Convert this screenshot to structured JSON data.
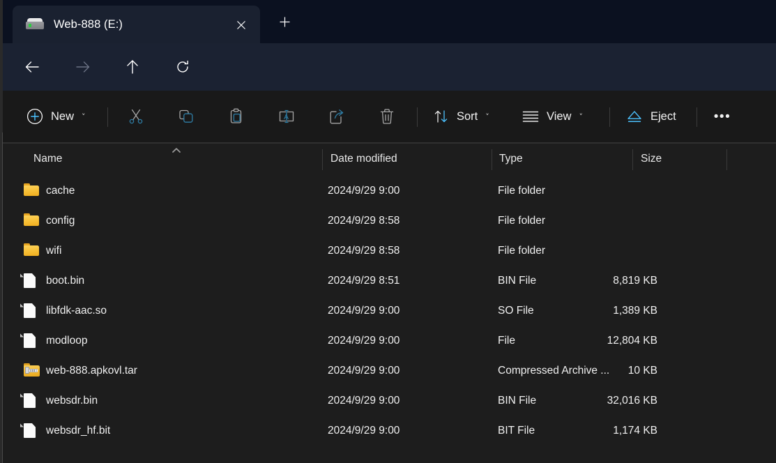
{
  "window": {
    "tab": {
      "title": "Web-888 (E:)",
      "icon": "drive-icon",
      "close_label": "✕"
    },
    "new_tab_label": "+"
  },
  "navigation": {
    "back": "back-arrow",
    "forward": "forward-arrow",
    "up": "up-arrow",
    "refresh": "refresh-icon",
    "breadcrumb": {
      "home_icon": "this-pc-icon",
      "separator": "›",
      "path_label": "Web-888 (E:)",
      "trailing_separator": "›"
    }
  },
  "toolbar": {
    "new_label": "New",
    "new_chevron": "˅",
    "cut_label": "Cut",
    "copy_label": "Copy",
    "paste_label": "Paste",
    "rename_label": "Rename",
    "share_label": "Share",
    "delete_label": "Delete",
    "sort_label": "Sort",
    "sort_chevron": "˅",
    "view_label": "View",
    "view_chevron": "˅",
    "eject_label": "Eject",
    "more_label": "•••"
  },
  "columns": {
    "name": "Name",
    "date_modified": "Date modified",
    "type": "Type",
    "size": "Size",
    "sort_indicator": "ascending"
  },
  "files": [
    {
      "name": "cache",
      "date": "2024/9/29 9:00",
      "type": "File folder",
      "size": "",
      "icon": "folder-icon"
    },
    {
      "name": "config",
      "date": "2024/9/29 8:58",
      "type": "File folder",
      "size": "",
      "icon": "folder-icon"
    },
    {
      "name": "wifi",
      "date": "2024/9/29 8:58",
      "type": "File folder",
      "size": "",
      "icon": "folder-icon"
    },
    {
      "name": "boot.bin",
      "date": "2024/9/29 8:51",
      "type": "BIN File",
      "size": "8,819 KB",
      "icon": "file-icon"
    },
    {
      "name": "libfdk-aac.so",
      "date": "2024/9/29 9:00",
      "type": "SO File",
      "size": "1,389 KB",
      "icon": "file-icon"
    },
    {
      "name": "modloop",
      "date": "2024/9/29 9:00",
      "type": "File",
      "size": "12,804 KB",
      "icon": "file-icon"
    },
    {
      "name": "web-888.apkovl.tar",
      "date": "2024/9/29 9:00",
      "type": "Compressed Archive ...",
      "size": "10 KB",
      "icon": "archive-icon"
    },
    {
      "name": "websdr.bin",
      "date": "2024/9/29 9:00",
      "type": "BIN File",
      "size": "32,016 KB",
      "icon": "file-icon"
    },
    {
      "name": "websdr_hf.bit",
      "date": "2024/9/29 9:00",
      "type": "BIT File",
      "size": "1,174 KB",
      "icon": "file-icon"
    }
  ],
  "colors": {
    "tabstrip_bg": "#0b1120",
    "active_tab_bg": "#1a2130",
    "navbar_bg": "#1b2232",
    "breadcrumb_bg": "#2b3344",
    "toolbar_bg": "#191919",
    "list_bg": "#1d1d1d",
    "accent_blue": "#4cc2ff",
    "folder_yellow": "#f8c23b",
    "text_primary": "#ffffff"
  }
}
